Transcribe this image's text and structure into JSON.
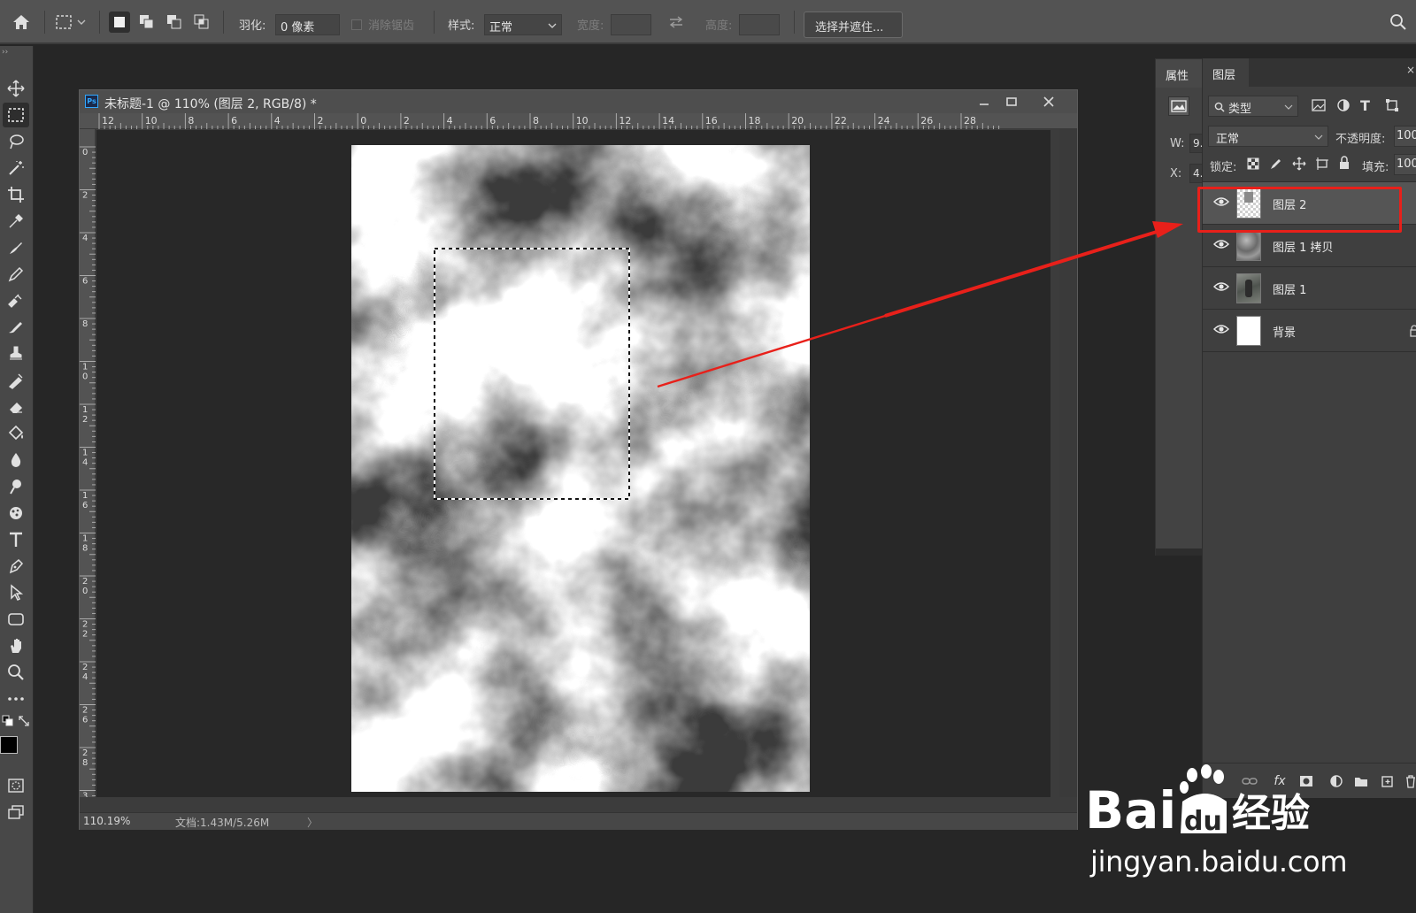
{
  "options_bar": {
    "feather_label": "羽化:",
    "feather_value": "0 像素",
    "antialias_label": "消除锯齿",
    "style_label": "样式:",
    "style_value": "正常",
    "width_label": "宽度:",
    "height_label": "高度:",
    "select_mask_button": "选择并遮住..."
  },
  "document": {
    "title": "未标题-1 @ 110% (图层 2, RGB/8) *",
    "ps_badge": "Ps",
    "zoom": "110.19%",
    "doc_info": "文档:1.43M/5.26M",
    "status_arrow": "〉",
    "ruler_h": [
      "12",
      "10",
      "8",
      "6",
      "4",
      "2",
      "0",
      "2",
      "4",
      "6",
      "8",
      "10",
      "12",
      "14",
      "16",
      "18",
      "20",
      "22",
      "24",
      "26",
      "28"
    ],
    "ruler_v": [
      "0",
      "2",
      "4",
      "6",
      "8",
      "10",
      "12",
      "14",
      "16",
      "18",
      "20",
      "22",
      "24",
      "26",
      "28",
      "3"
    ]
  },
  "properties_panel": {
    "tab": "属性",
    "w_label": "W:",
    "w_value": "9.",
    "x_label": "X:",
    "x_value": "4."
  },
  "layers_panel": {
    "tab": "图层",
    "filter_kind": "类型",
    "blend_mode": "正常",
    "opacity_label": "不透明度:",
    "opacity_value": "100",
    "lock_label": "锁定:",
    "fill_label": "填充:",
    "fill_value": "100",
    "layers": [
      {
        "name": "图层 2",
        "selected": true
      },
      {
        "name": "图层 1 拷贝",
        "selected": false
      },
      {
        "name": "图层 1",
        "selected": false
      },
      {
        "name": "背景",
        "selected": false
      }
    ]
  },
  "watermark": {
    "brand_text": "Bai du 经验",
    "url": "jingyan.baidu.com"
  },
  "colors": {
    "annotation_red": "#e8201a",
    "selected_layer": "#555555"
  }
}
